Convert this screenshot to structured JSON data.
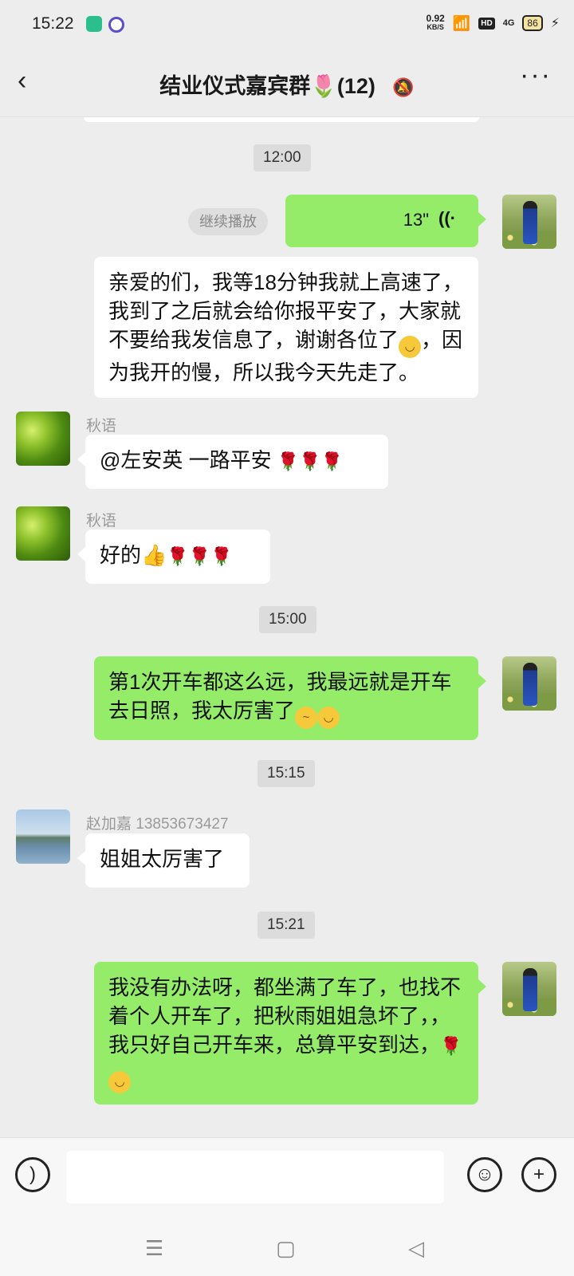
{
  "status_bar": {
    "time": "15:22",
    "net_speed_value": "0.92",
    "net_speed_unit": "KB/S",
    "hd": "HD",
    "signal": "4G",
    "battery": "86"
  },
  "header": {
    "title": "结业仪式嘉宾群🌷(12)",
    "back_icon": "chevron-left-icon",
    "mute_icon": "bell-off-icon",
    "more_icon": "more-dots-icon"
  },
  "messages": {
    "t1": "12:00",
    "voice_duration": "13\"",
    "resume_label": "继续播放",
    "m1_text": "亲爱的们，我等18分钟我就上高速了，我到了之后就会给你报平安了，大家就不要给我发信息了，谢谢各位了",
    "m1_tail": "因为我开的慢，所以我今天先走了。",
    "sender_qiuyu": "秋语",
    "m2_text": "@左安英  一路平安",
    "m3_text": "好的",
    "t2": "15:00",
    "m4_text": "第1次开车都这么远，我最远就是开车去日照，我太厉害了",
    "t3": "15:15",
    "sender_zhao": "赵加嘉 13853673427",
    "m5_text": "姐姐太厉害了",
    "t4": "15:21",
    "m6_text": "我没有办法呀，都坐满了车了，也找不着个人开车了，把秋雨姐姐急坏了，，我只好自己开车来，总算平安到达，"
  },
  "input_bar": {
    "voice_icon": "voice-input-icon",
    "emoji_icon": "emoji-icon",
    "plus_icon": "plus-icon"
  },
  "nav": {
    "menu_icon": "menu-icon",
    "home_icon": "home-icon",
    "back_icon": "back-triangle-icon"
  }
}
